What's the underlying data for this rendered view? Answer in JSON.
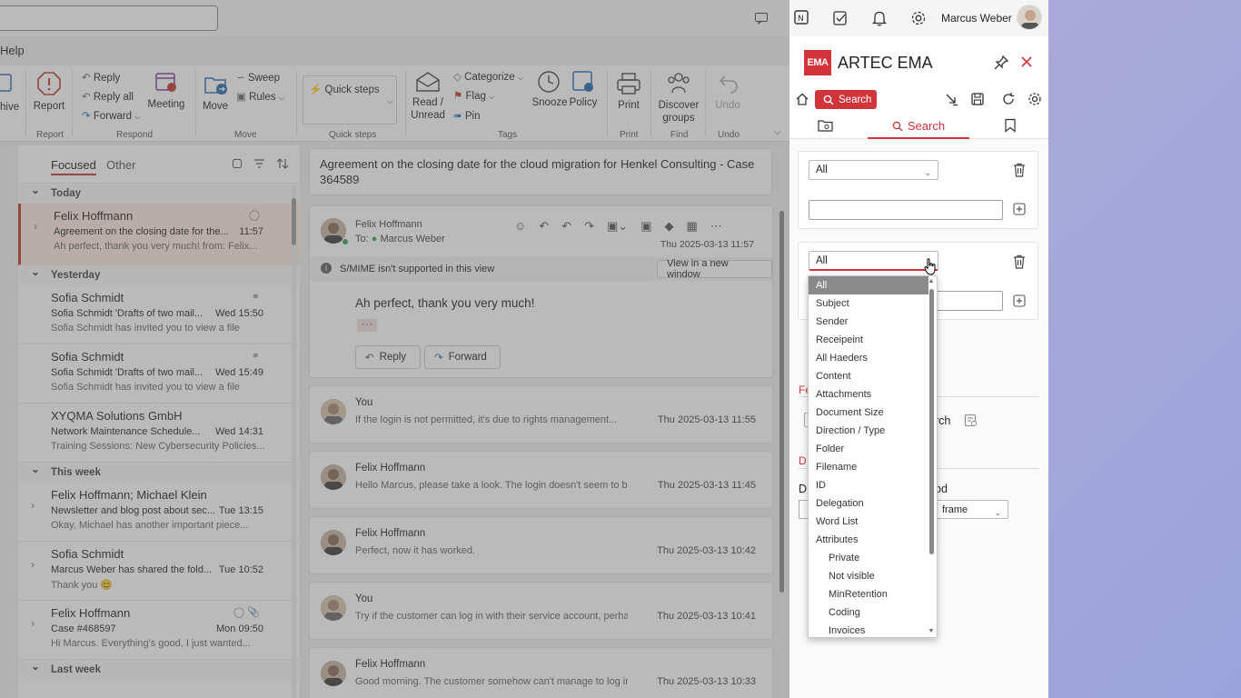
{
  "outlook": {
    "menu_help": "Help",
    "ribbon": {
      "archive": "hive",
      "report": "Report",
      "reply": "Reply",
      "reply_all": "Reply all",
      "forward": "Forward",
      "meeting": "Meeting",
      "move": "Move",
      "sweep": "Sweep",
      "rules": "Rules",
      "quick_steps": "Quick steps",
      "read_unread_1": "Read /",
      "read_unread_2": "Unread",
      "categorize": "Categorize",
      "flag": "Flag",
      "pin": "Pin",
      "snooze": "Snooze",
      "policy": "Policy",
      "print": "Print",
      "discover_1": "Discover",
      "discover_2": "groups",
      "undo": "Undo",
      "groups": {
        "report": "Report",
        "respond": "Respond",
        "move": "Move",
        "quick_steps": "Quick steps",
        "tags": "Tags",
        "print": "Print",
        "find": "Find",
        "undo": "Undo"
      }
    },
    "list": {
      "tab_focused": "Focused",
      "tab_other": "Other",
      "sections": {
        "today": "Today",
        "yesterday": "Yesterday",
        "this_week": "This week",
        "last_week": "Last week"
      },
      "items": [
        {
          "from": "Felix Hoffmann",
          "subject": "Agreement on the closing date for the...",
          "time": "11:57",
          "preview": "Ah perfect, thank you very much! from: Felix..."
        },
        {
          "from": "Sofia Schmidt",
          "subject": "Sofia Schmidt 'Drafts of two mail...",
          "time": "Wed 15:50",
          "preview": "Sofia Schmidt has invited you to view a file"
        },
        {
          "from": "Sofia Schmidt",
          "subject": "Sofia Schmidt 'Drafts of two mail...",
          "time": "Wed 15:49",
          "preview": "Sofia Schmidt has invited you to view a file"
        },
        {
          "from": "XYQMA Solutions GmbH",
          "subject": "Network Maintenance Schedule...",
          "time": "Wed 14:31",
          "preview": "Training Sessions: New Cybersecurity Policies..."
        },
        {
          "from": "Felix Hoffmann; Michael Klein",
          "subject": "Newsletter and blog post about sec...",
          "time": "Tue 13:15",
          "preview": "Okay, Michael has another important piece..."
        },
        {
          "from": "Sofia Schmidt",
          "subject": "Marcus Weber has shared the fold...",
          "time": "Tue 10:52",
          "preview": "Thank you 😊"
        },
        {
          "from": "Felix Hoffmann",
          "subject": "Case #468597",
          "time": "Mon 09:50",
          "preview": "Hi Marcus. Everything's good, I just wanted..."
        }
      ]
    },
    "reading": {
      "subject": "Agreement on the closing date for the cloud migration for Henkel Consulting - Case 364589",
      "sender": "Felix Hoffmann",
      "to_label": "To:",
      "to": "Marcus Weber",
      "date": "Thu 2025-03-13 11:57",
      "smime": "S/MIME isn't supported in this view",
      "view_new_window": "View in a new window",
      "body": "Ah perfect, thank you very much!",
      "dots": "···",
      "reply": "Reply",
      "forward": "Forward",
      "thread": [
        {
          "name": "You",
          "preview": "If the login is not permitted, it's due to rights management...",
          "time": "Thu 2025-03-13 11:55"
        },
        {
          "name": "Felix Hoffmann",
          "preview": "Hello Marcus, please take a look. The login doesn't seem to b...",
          "time": "Thu 2025-03-13 11:45"
        },
        {
          "name": "Felix Hoffmann",
          "preview": "Perfect, now it has worked.",
          "time": "Thu 2025-03-13 10:42"
        },
        {
          "name": "You",
          "preview": "Try if the customer can log in with their service account, perhaps...",
          "time": "Thu 2025-03-13 10:41"
        },
        {
          "name": "Felix Hoffmann",
          "preview": "Good morning. The customer somehow can't manage to log into...",
          "time": "Thu 2025-03-13 10:33"
        }
      ]
    }
  },
  "panel": {
    "user_name": "Marcus Weber",
    "logo_text": "EMA",
    "title": "ARTEC EMA",
    "search_button": "Search",
    "tab_search": "Search",
    "select1_value": "All",
    "select2_value": "All",
    "partial_rch": "rch",
    "partial_fe": "Fe",
    "partial_d1": "D",
    "partial_d2": "D",
    "partial_od": "od",
    "partial_frame": "frame",
    "accent": "#d1343a"
  },
  "dropdown": {
    "options": [
      {
        "label": "All",
        "selected": true
      },
      {
        "label": "Subject"
      },
      {
        "label": "Sender"
      },
      {
        "label": "Receipeint"
      },
      {
        "label": "All Haeders"
      },
      {
        "label": "Content"
      },
      {
        "label": "Attachments"
      },
      {
        "label": "Document Size"
      },
      {
        "label": "Direction / Type"
      },
      {
        "label": "Folder"
      },
      {
        "label": "Filename"
      },
      {
        "label": "ID"
      },
      {
        "label": "Delegation"
      },
      {
        "label": "Word List"
      },
      {
        "label": "Attributes",
        "group": true
      },
      {
        "label": "Private",
        "sub": true
      },
      {
        "label": "Not visible",
        "sub": true
      },
      {
        "label": "MinRetention",
        "sub": true
      },
      {
        "label": "Coding",
        "sub": true
      },
      {
        "label": "Invoices",
        "sub": true
      }
    ]
  }
}
